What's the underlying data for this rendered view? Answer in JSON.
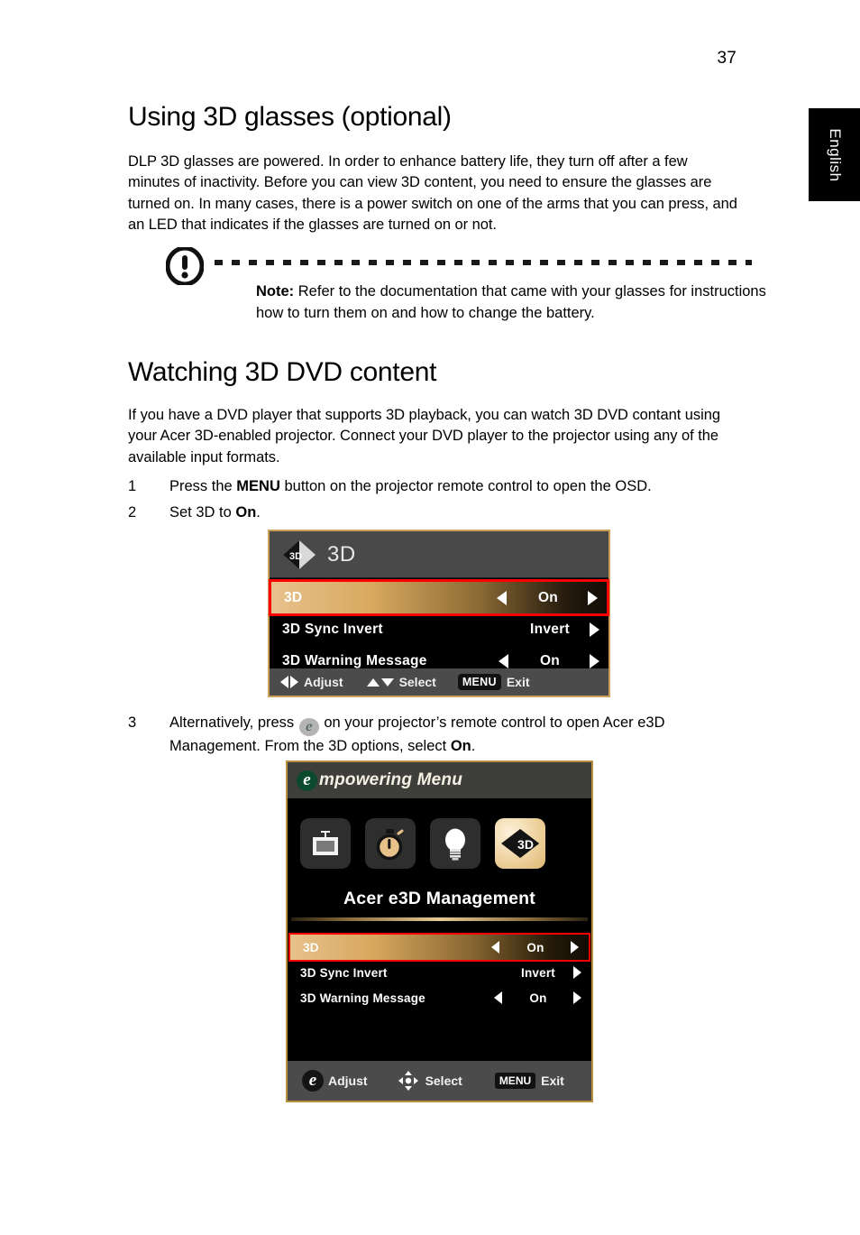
{
  "page": {
    "number": "37",
    "language_tab": "English"
  },
  "sections": [
    {
      "heading": "Using 3D glasses (optional)",
      "body": "DLP 3D glasses are powered. In order to enhance battery life, they turn off after a few minutes of inactivity. Before you can view 3D content, you need to ensure the glasses are turned on. In many cases, there is a power switch on one of the arms that you can press, and an LED that indicates if the glasses are turned on or not."
    },
    {
      "heading": "Watching 3D DVD content",
      "body": "If you have a DVD player that supports 3D playback, you can watch 3D DVD contant using your Acer 3D-enabled projector. Connect your DVD player to the projector using any of the available input formats."
    }
  ],
  "note": {
    "icon": "exclamation-circle-icon",
    "label": "Note:",
    "text": "Refer to the documentation that came with your glasses for instructions how to turn them on and how to change the battery."
  },
  "steps": [
    {
      "number": "1",
      "text_before": "Press the ",
      "bold": "MENU",
      "text_after": " button on the projector remote control to open the OSD."
    },
    {
      "number": "2",
      "text_before": "Set 3D to ",
      "bold": "On",
      "text_after": "."
    },
    {
      "number": "3",
      "text_before": "Alternatively, press ",
      "inline_icon": "e",
      "text_mid": " on your projector’s remote control to open Acer e3D Management. From the 3D options, select ",
      "bold": "On",
      "text_after": "."
    }
  ],
  "osd_menu": {
    "header_icon": "3d-diamond-icon",
    "header_title": "3D",
    "rows": [
      {
        "label": "3D",
        "value": "On",
        "left_arrow": true,
        "right_arrow": true,
        "selected": true
      },
      {
        "label": "3D Sync Invert",
        "value": "Invert",
        "left_arrow": false,
        "right_arrow": true,
        "selected": false
      },
      {
        "label": "3D Warning Message",
        "value": "On",
        "left_arrow": true,
        "right_arrow": true,
        "selected": false
      }
    ],
    "footer": {
      "adjust_label": "Adjust",
      "select_label": "Select",
      "menu_key": "MENU",
      "exit_label": "Exit"
    },
    "colors": {
      "border": "#c8a05a",
      "header_bg": "#494949",
      "body_bg": "#000000",
      "footer_bg": "#4b4b4b",
      "selection_outline": "#ff0000",
      "highlight_gold": "#d8a95f"
    }
  },
  "empowering_menu": {
    "header_e": "e",
    "header_title": "mpowering Menu",
    "icons": [
      {
        "name": "display-screen-icon",
        "active": false
      },
      {
        "name": "timer-stopwatch-icon",
        "active": false
      },
      {
        "name": "lightbulb-icon",
        "active": false
      },
      {
        "name": "3d-diamond-icon",
        "active": true
      }
    ],
    "title": "Acer e3D Management",
    "rows": [
      {
        "label": "3D",
        "value": "On",
        "left_arrow": true,
        "right_arrow": true,
        "selected": true
      },
      {
        "label": "3D Sync Invert",
        "value": "Invert",
        "left_arrow": false,
        "right_arrow": true,
        "selected": false
      },
      {
        "label": "3D Warning Message",
        "value": "On",
        "left_arrow": true,
        "right_arrow": true,
        "selected": false
      }
    ],
    "footer": {
      "adjust_icon": "e",
      "adjust_label": "Adjust",
      "select_icon": "dpad-icon",
      "select_label": "Select",
      "menu_key": "MENU",
      "exit_label": "Exit"
    },
    "colors": {
      "border": "#b8913f",
      "header_bg": "#3e3e3b",
      "e_badge_bg": "#0c4a2d",
      "active_icon_gold": "#f1d8a9",
      "rule_gold": "#e6cb92"
    }
  }
}
